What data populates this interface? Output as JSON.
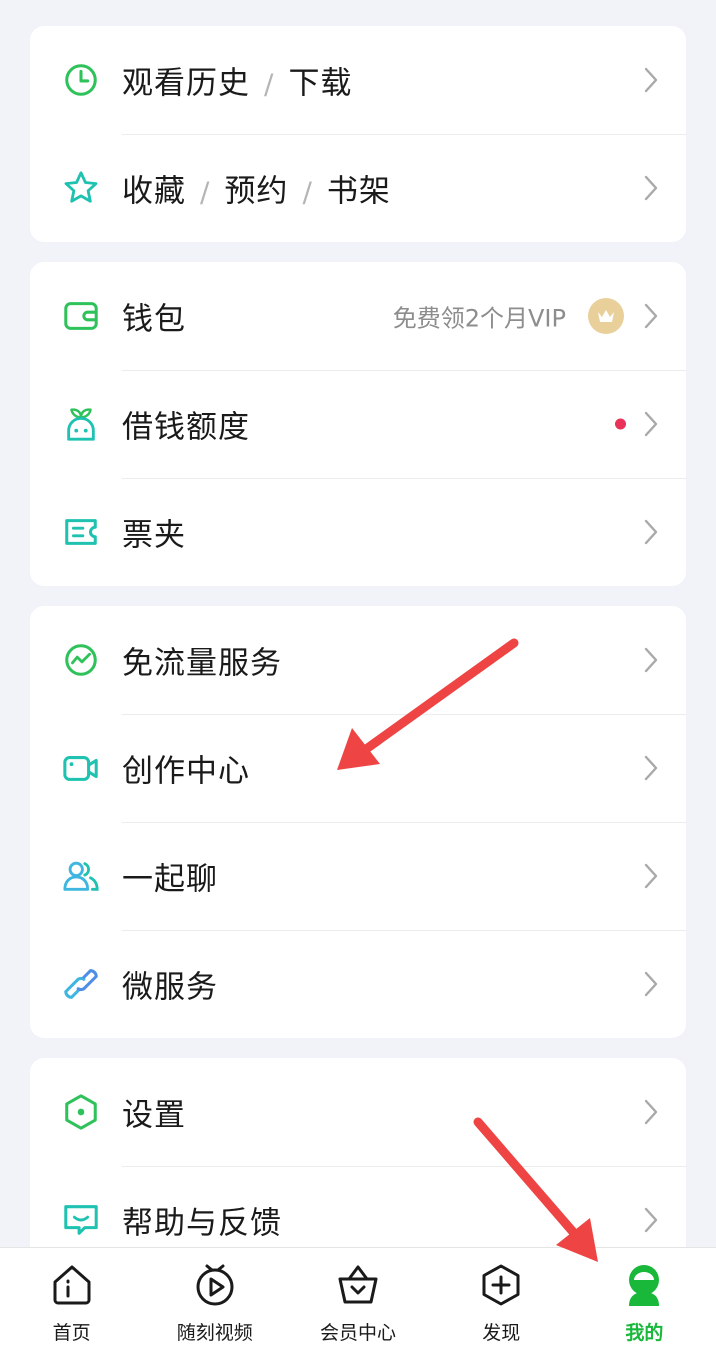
{
  "groups": [
    {
      "rows": [
        {
          "icon": "clock-icon",
          "parts": [
            "观看历史",
            "下载"
          ]
        },
        {
          "icon": "star-icon",
          "parts": [
            "收藏",
            "预约",
            "书架"
          ]
        }
      ]
    },
    {
      "rows": [
        {
          "icon": "wallet-icon",
          "label": "钱包",
          "hint": "免费领2个月VIP",
          "badge": "vip-crown-icon"
        },
        {
          "icon": "sprout-icon",
          "label": "借钱额度",
          "dot": true
        },
        {
          "icon": "ticket-icon",
          "label": "票夹"
        }
      ]
    },
    {
      "rows": [
        {
          "icon": "traffic-icon",
          "label": "免流量服务"
        },
        {
          "icon": "video-camera-icon",
          "label": "创作中心"
        },
        {
          "icon": "people-icon",
          "label": "一起聊"
        },
        {
          "icon": "link-icon",
          "label": "微服务"
        }
      ]
    },
    {
      "rows": [
        {
          "icon": "settings-hexagon-icon",
          "label": "设置"
        },
        {
          "icon": "feedback-icon",
          "label": "帮助与反馈"
        }
      ]
    }
  ],
  "tabbar": {
    "tabs": [
      {
        "icon": "home-icon",
        "label": "首页"
      },
      {
        "icon": "video-play-icon",
        "label": "随刻视频"
      },
      {
        "icon": "member-basket-icon",
        "label": "会员中心"
      },
      {
        "icon": "add-circle-icon",
        "label": "发现"
      },
      {
        "icon": "profile-icon",
        "label": "我的",
        "active": true
      }
    ]
  },
  "colors": {
    "accent_green": "#19b83b",
    "icon_green": "#2fc25b",
    "icon_teal": "#1fc2b0",
    "badge_red": "#e8325a",
    "vip_gold": "#e9cf9a",
    "annotation_red": "#ef4444"
  }
}
